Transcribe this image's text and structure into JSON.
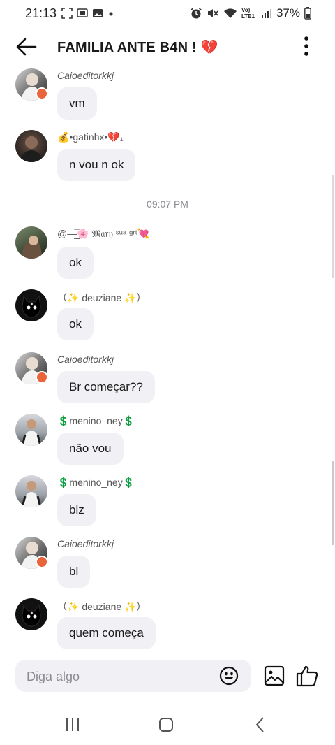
{
  "status_bar": {
    "time": "21:13",
    "battery": "37%",
    "network_label": "Vo) LTE1",
    "icons": [
      "screenshot-icon",
      "cast-icon",
      "image-icon",
      "dot-icon",
      "alarm-icon",
      "mute-icon",
      "wifi-icon",
      "signal-icon",
      "battery-icon"
    ]
  },
  "header": {
    "title": "FAMILIA ANTE B4N ! 💔",
    "icons": [
      "back-arrow-icon",
      "more-vertical-icon"
    ]
  },
  "colors": {
    "bubble_bg": "#f1f0f4",
    "badge": "#e9633b",
    "divider": "#e9e9ee"
  },
  "messages": [
    {
      "sender": "Caioeditorkkj",
      "text": "vm",
      "avatar": "avatar-caio",
      "badge": true
    },
    {
      "sender": "💰•gatinhx•💔₁",
      "text": "n vou n ok",
      "avatar": "avatar-gatinhx",
      "badge": false
    },
    {
      "sender": "@—̲̅🌸 𝔐𝔞𝔯𝔶 ˢᵘᵃ ᵍʳᵗ💘",
      "text": "ok",
      "avatar": "avatar-mary",
      "badge": false
    },
    {
      "sender": "（✨ deuziane ✨）",
      "text": "ok",
      "avatar": "avatar-deuziane",
      "badge": false
    },
    {
      "sender": "Caioeditorkkj",
      "text": "Br começar??",
      "avatar": "avatar-caio",
      "badge": true
    },
    {
      "sender": "💲menino_ney💲",
      "text": "não vou",
      "avatar": "avatar-ney",
      "badge": false
    },
    {
      "sender": "💲menino_ney💲",
      "text": "blz",
      "avatar": "avatar-ney",
      "badge": false
    },
    {
      "sender": "Caioeditorkkj",
      "text": "bl",
      "avatar": "avatar-caio",
      "badge": true
    },
    {
      "sender": "（✨ deuziane ✨）",
      "text": "quem começa",
      "avatar": "avatar-deuziane",
      "badge": false
    }
  ],
  "timestamp": "09:07 PM",
  "composer": {
    "placeholder": "Diga algo",
    "icons": [
      "emoji-icon",
      "gallery-icon",
      "thumbs-up-icon"
    ]
  },
  "nav_bar": {
    "icons": [
      "recents-icon",
      "home-icon",
      "back-icon"
    ]
  }
}
